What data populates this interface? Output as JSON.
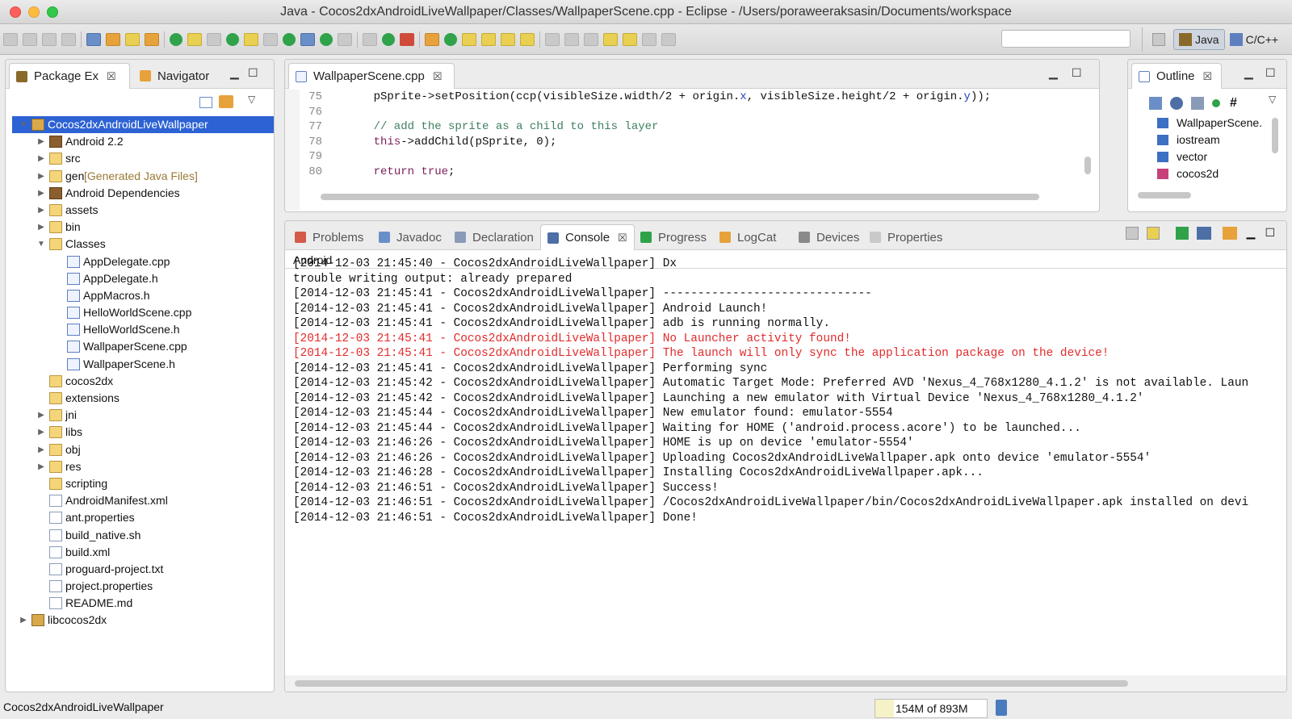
{
  "window": {
    "title": "Java - Cocos2dxAndroidLiveWallpaper/Classes/WallpaperScene.cpp - Eclipse - /Users/poraweeraksasin/Documents/workspace"
  },
  "perspectives": [
    "Java",
    "C/C++"
  ],
  "left_panel": {
    "tabs": [
      "Package Ex",
      "Navigator"
    ],
    "tree": [
      {
        "label": "Cocos2dxAndroidLiveWallpaper",
        "depth": 0,
        "arrow": "down",
        "icon": "proj",
        "selected": true
      },
      {
        "label": "Android 2.2",
        "depth": 1,
        "arrow": "right",
        "icon": "lib"
      },
      {
        "label": "src",
        "depth": 1,
        "arrow": "right",
        "icon": "fold"
      },
      {
        "label": "gen",
        "decor": " [Generated Java Files]",
        "depth": 1,
        "arrow": "right",
        "icon": "fold"
      },
      {
        "label": "Android Dependencies",
        "depth": 1,
        "arrow": "right",
        "icon": "lib"
      },
      {
        "label": "assets",
        "depth": 1,
        "arrow": "right",
        "icon": "fold"
      },
      {
        "label": "bin",
        "depth": 1,
        "arrow": "right",
        "icon": "fold"
      },
      {
        "label": "Classes",
        "depth": 1,
        "arrow": "down",
        "icon": "fold"
      },
      {
        "label": "AppDelegate.cpp",
        "depth": 2,
        "icon": "filec"
      },
      {
        "label": "AppDelegate.h",
        "depth": 2,
        "icon": "filec"
      },
      {
        "label": "AppMacros.h",
        "depth": 2,
        "icon": "filec"
      },
      {
        "label": "HelloWorldScene.cpp",
        "depth": 2,
        "icon": "filec"
      },
      {
        "label": "HelloWorldScene.h",
        "depth": 2,
        "icon": "filec"
      },
      {
        "label": "WallpaperScene.cpp",
        "depth": 2,
        "icon": "filec"
      },
      {
        "label": "WallpaperScene.h",
        "depth": 2,
        "icon": "filec"
      },
      {
        "label": "cocos2dx",
        "depth": 1,
        "icon": "fold"
      },
      {
        "label": "extensions",
        "depth": 1,
        "icon": "fold"
      },
      {
        "label": "jni",
        "depth": 1,
        "arrow": "right",
        "icon": "fold"
      },
      {
        "label": "libs",
        "depth": 1,
        "arrow": "right",
        "icon": "fold"
      },
      {
        "label": "obj",
        "depth": 1,
        "arrow": "right",
        "icon": "fold"
      },
      {
        "label": "res",
        "depth": 1,
        "arrow": "right",
        "icon": "fold"
      },
      {
        "label": "scripting",
        "depth": 1,
        "icon": "fold"
      },
      {
        "label": "AndroidManifest.xml",
        "depth": 1,
        "icon": "file"
      },
      {
        "label": "ant.properties",
        "depth": 1,
        "icon": "file"
      },
      {
        "label": "build_native.sh",
        "depth": 1,
        "icon": "file"
      },
      {
        "label": "build.xml",
        "depth": 1,
        "icon": "file"
      },
      {
        "label": "proguard-project.txt",
        "depth": 1,
        "icon": "file"
      },
      {
        "label": "project.properties",
        "depth": 1,
        "icon": "file"
      },
      {
        "label": "README.md",
        "depth": 1,
        "icon": "file"
      },
      {
        "label": "libcocos2dx",
        "depth": 0,
        "arrow": "right",
        "icon": "proj"
      }
    ]
  },
  "editor": {
    "tab": "WallpaperScene.cpp",
    "lines": [
      {
        "n": "75",
        "segs": [
          {
            "t": "    pSprite->setPosition(ccp(visibleSize.width/2 + origin."
          },
          {
            "t": "x",
            "c": "fld"
          },
          {
            "t": ", visibleSize.height/2 + origin."
          },
          {
            "t": "y",
            "c": "fld"
          },
          {
            "t": "));"
          }
        ]
      },
      {
        "n": "76",
        "segs": [
          {
            "t": ""
          }
        ]
      },
      {
        "n": "77",
        "segs": [
          {
            "t": "    // add the sprite as a child to this layer",
            "c": "cm"
          }
        ]
      },
      {
        "n": "78",
        "segs": [
          {
            "t": "    "
          },
          {
            "t": "this",
            "c": "kw"
          },
          {
            "t": "->addChild(pSprite, 0);"
          }
        ]
      },
      {
        "n": "79",
        "segs": [
          {
            "t": ""
          }
        ]
      },
      {
        "n": "80",
        "segs": [
          {
            "t": "    "
          },
          {
            "t": "return",
            "c": "kw"
          },
          {
            "t": " "
          },
          {
            "t": "true",
            "c": "kw"
          },
          {
            "t": ";"
          }
        ]
      }
    ]
  },
  "outline": {
    "tab": "Outline",
    "items": [
      "WallpaperScene.",
      "iostream",
      "vector",
      "cocos2d"
    ]
  },
  "bottom_tabs": [
    {
      "label": "Problems"
    },
    {
      "label": "Javadoc"
    },
    {
      "label": "Declaration"
    },
    {
      "label": "Console",
      "active": true
    },
    {
      "label": "Progress"
    },
    {
      "label": "LogCat"
    },
    {
      "label": "Devices"
    },
    {
      "label": "Properties"
    }
  ],
  "console": {
    "header": "Android",
    "lines": [
      {
        "t": "[2014-12-03 21:45:40 - Cocos2dxAndroidLiveWallpaper] Dx"
      },
      {
        "t": "trouble writing output: already prepared"
      },
      {
        "t": "[2014-12-03 21:45:41 - Cocos2dxAndroidLiveWallpaper] ------------------------------"
      },
      {
        "t": "[2014-12-03 21:45:41 - Cocos2dxAndroidLiveWallpaper] Android Launch!"
      },
      {
        "t": "[2014-12-03 21:45:41 - Cocos2dxAndroidLiveWallpaper] adb is running normally."
      },
      {
        "t": "[2014-12-03 21:45:41 - Cocos2dxAndroidLiveWallpaper] No Launcher activity found!",
        "err": true
      },
      {
        "t": "[2014-12-03 21:45:41 - Cocos2dxAndroidLiveWallpaper] The launch will only sync the application package on the device!",
        "err": true
      },
      {
        "t": "[2014-12-03 21:45:41 - Cocos2dxAndroidLiveWallpaper] Performing sync"
      },
      {
        "t": "[2014-12-03 21:45:42 - Cocos2dxAndroidLiveWallpaper] Automatic Target Mode: Preferred AVD 'Nexus_4_768x1280_4.1.2' is not available. Laun"
      },
      {
        "t": "[2014-12-03 21:45:42 - Cocos2dxAndroidLiveWallpaper] Launching a new emulator with Virtual Device 'Nexus_4_768x1280_4.1.2'"
      },
      {
        "t": "[2014-12-03 21:45:44 - Cocos2dxAndroidLiveWallpaper] New emulator found: emulator-5554"
      },
      {
        "t": "[2014-12-03 21:45:44 - Cocos2dxAndroidLiveWallpaper] Waiting for HOME ('android.process.acore') to be launched..."
      },
      {
        "t": "[2014-12-03 21:46:26 - Cocos2dxAndroidLiveWallpaper] HOME is up on device 'emulator-5554'"
      },
      {
        "t": "[2014-12-03 21:46:26 - Cocos2dxAndroidLiveWallpaper] Uploading Cocos2dxAndroidLiveWallpaper.apk onto device 'emulator-5554'"
      },
      {
        "t": "[2014-12-03 21:46:28 - Cocos2dxAndroidLiveWallpaper] Installing Cocos2dxAndroidLiveWallpaper.apk..."
      },
      {
        "t": "[2014-12-03 21:46:51 - Cocos2dxAndroidLiveWallpaper] Success!"
      },
      {
        "t": "[2014-12-03 21:46:51 - Cocos2dxAndroidLiveWallpaper] /Cocos2dxAndroidLiveWallpaper/bin/Cocos2dxAndroidLiveWallpaper.apk installed on devi"
      },
      {
        "t": "[2014-12-03 21:46:51 - Cocos2dxAndroidLiveWallpaper] Done!"
      }
    ]
  },
  "status": {
    "left": "Cocos2dxAndroidLiveWallpaper",
    "memory": "154M of 893M",
    "memory_fraction": 0.17
  },
  "colors": {
    "selection": "#2c62d3",
    "error": "#e22b2b"
  }
}
